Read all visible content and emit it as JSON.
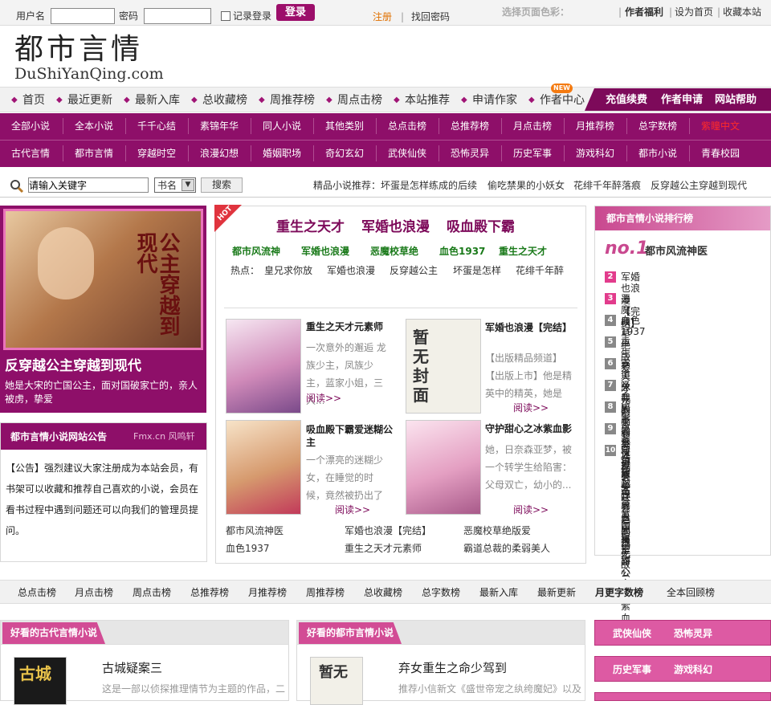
{
  "login": {
    "username_label": "用户名",
    "password_label": "密码",
    "remember_label": "记录登录",
    "login_button": "登录",
    "register": "注册",
    "find_password": "找回密码",
    "theme_label": "选择页面色彩：",
    "author_benefit": "作者福利",
    "set_home": "设为首页",
    "bookmark": "收藏本站"
  },
  "logo": {
    "cn": "都市言情",
    "en": "DuShiYanQing.com"
  },
  "nav": {
    "items": [
      "首页",
      "最近更新",
      "最新入库",
      "总收藏榜",
      "周推荐榜",
      "周点击榜",
      "本站推荐",
      "申请作家",
      "作者中心"
    ],
    "new_badge": "NEW",
    "right_items": [
      "充值续费",
      "作者申请",
      "网站帮助"
    ]
  },
  "categories": {
    "row1": [
      "全部小说",
      "全本小说",
      "千千心结",
      "素锦年华",
      "同人小说",
      "其他类别",
      "总点击榜",
      "总推荐榜",
      "月点击榜",
      "月推荐榜",
      "总字数榜",
      "紫瞳中文"
    ],
    "row2": [
      "古代言情",
      "都市言情",
      "穿越时空",
      "浪漫幻想",
      "婚姻职场",
      "奇幻玄幻",
      "武侠仙侠",
      "恐怖灵异",
      "历史军事",
      "游戏科幻",
      "都市小说",
      "青春校园"
    ]
  },
  "search": {
    "placeholder": "请输入关键字",
    "select_value": "书名",
    "button": "搜索",
    "recommend_label": "精品小说推荐：",
    "recommend": [
      "坏蛋是怎样练成的后续",
      "偷吃禁果的小妖女",
      "花绯千年醉落痕",
      "反穿越公主穿越到现代"
    ]
  },
  "feature": {
    "title": "反穿越公主穿越到现代",
    "desc": "她是大宋的亡国公主，面对国破家亡的，亲人被虏，挚爱",
    "cover_text": "公主穿越到现代"
  },
  "notice": {
    "title": "都市言情小说网站公告",
    "brand": "Fmx.cn 风鸣轩",
    "body": "【公告】强烈建议大家注册成为本站会员，有书架可以收藏和推荐自己喜欢的小说，会员在看书过程中遇到问题还可以向我们的管理员提问。"
  },
  "hot": {
    "badge": "HOT",
    "headline": [
      "重生之天才",
      "军婚也浪漫",
      "吸血殿下霸"
    ],
    "green_links": [
      "都市风流神",
      "军婚也浪漫",
      "恶魔校草绝",
      "血色1937",
      "重生之天才"
    ],
    "hot_label": "热点：",
    "hot_links": [
      "皇兄求你放",
      "军婚也浪漫",
      "反穿越公主",
      "坏蛋是怎样",
      "花绯千年醉"
    ],
    "books": [
      {
        "title": "重生之天才元素师",
        "desc": "一次意外的邂逅 龙族少主，凤族少主，蓝家小姐，三人...",
        "more": "阅读>>"
      },
      {
        "title": "军婚也浪漫【完结】",
        "desc": "【出版精品频道】【出版上市】他是精英中的精英，她是父...",
        "more": "阅读>>"
      },
      {
        "title": "吸血殿下霸爱迷糊公主",
        "desc": "一个漂亮的迷糊少女，在睡觉的时候，竟然被扔出了时空之...",
        "more": "阅读>>"
      },
      {
        "title": "守护甜心之冰紫血影",
        "desc": "她，日奈森亚梦，被一个转学生给陷害：父母双亡，幼小的...",
        "more": "阅读>>"
      }
    ],
    "bottom_links": [
      "都市风流神医",
      "军婚也浪漫【完结】",
      "恶魔校草绝版爱",
      "血色1937",
      "重生之天才元素师",
      "霸道总裁的柔弱美人"
    ]
  },
  "ranking": {
    "title": "都市言情小说排行榜",
    "no1_label": "no.1",
    "no1": "都市风流神医",
    "items": [
      "军婚也浪漫【完结】",
      "恶魔校草绝版爱",
      "血色1937",
      "重生之天才元素师",
      "霸道总裁的柔弱美人",
      "吸血殿下霸爱迷糊公主",
      "火影之永远爱罗",
      "总裁哥哥真美味",
      "守护甜心之紫色的记忆",
      "穿越异界之兄独无敌",
      "独爱丑王夫",
      "英国皇室冷公主",
      "守护甜心之冰紫血影"
    ]
  },
  "bottom_nav": [
    "总点击榜",
    "月点击榜",
    "周点击榜",
    "总推荐榜",
    "月推荐榜",
    "周推荐榜",
    "总收藏榜",
    "总字数榜",
    "最新入库",
    "最新更新",
    "月更字数榜",
    "全本回顾榜"
  ],
  "sections": {
    "ancient": {
      "title": "好看的古代言情小说",
      "book": "古城疑案三",
      "desc": "这是一部以侦探推理情节为主题的作品，二",
      "cover": "古城"
    },
    "urban": {
      "title": "好看的都市言情小说",
      "book": "弃女重生之命少驾到",
      "desc": "推荐小信新文《盛世帝宠之纨绔魔妃》以及",
      "cover": "暂无"
    },
    "side_buttons": [
      [
        "武侠仙侠",
        "恐怖灵异"
      ],
      [
        "历史军事",
        "游戏科幻"
      ]
    ]
  },
  "colors": {
    "brand_purple": "#8e0f69",
    "accent_pink": "#c9488f",
    "highlight_red": "#e00000"
  }
}
